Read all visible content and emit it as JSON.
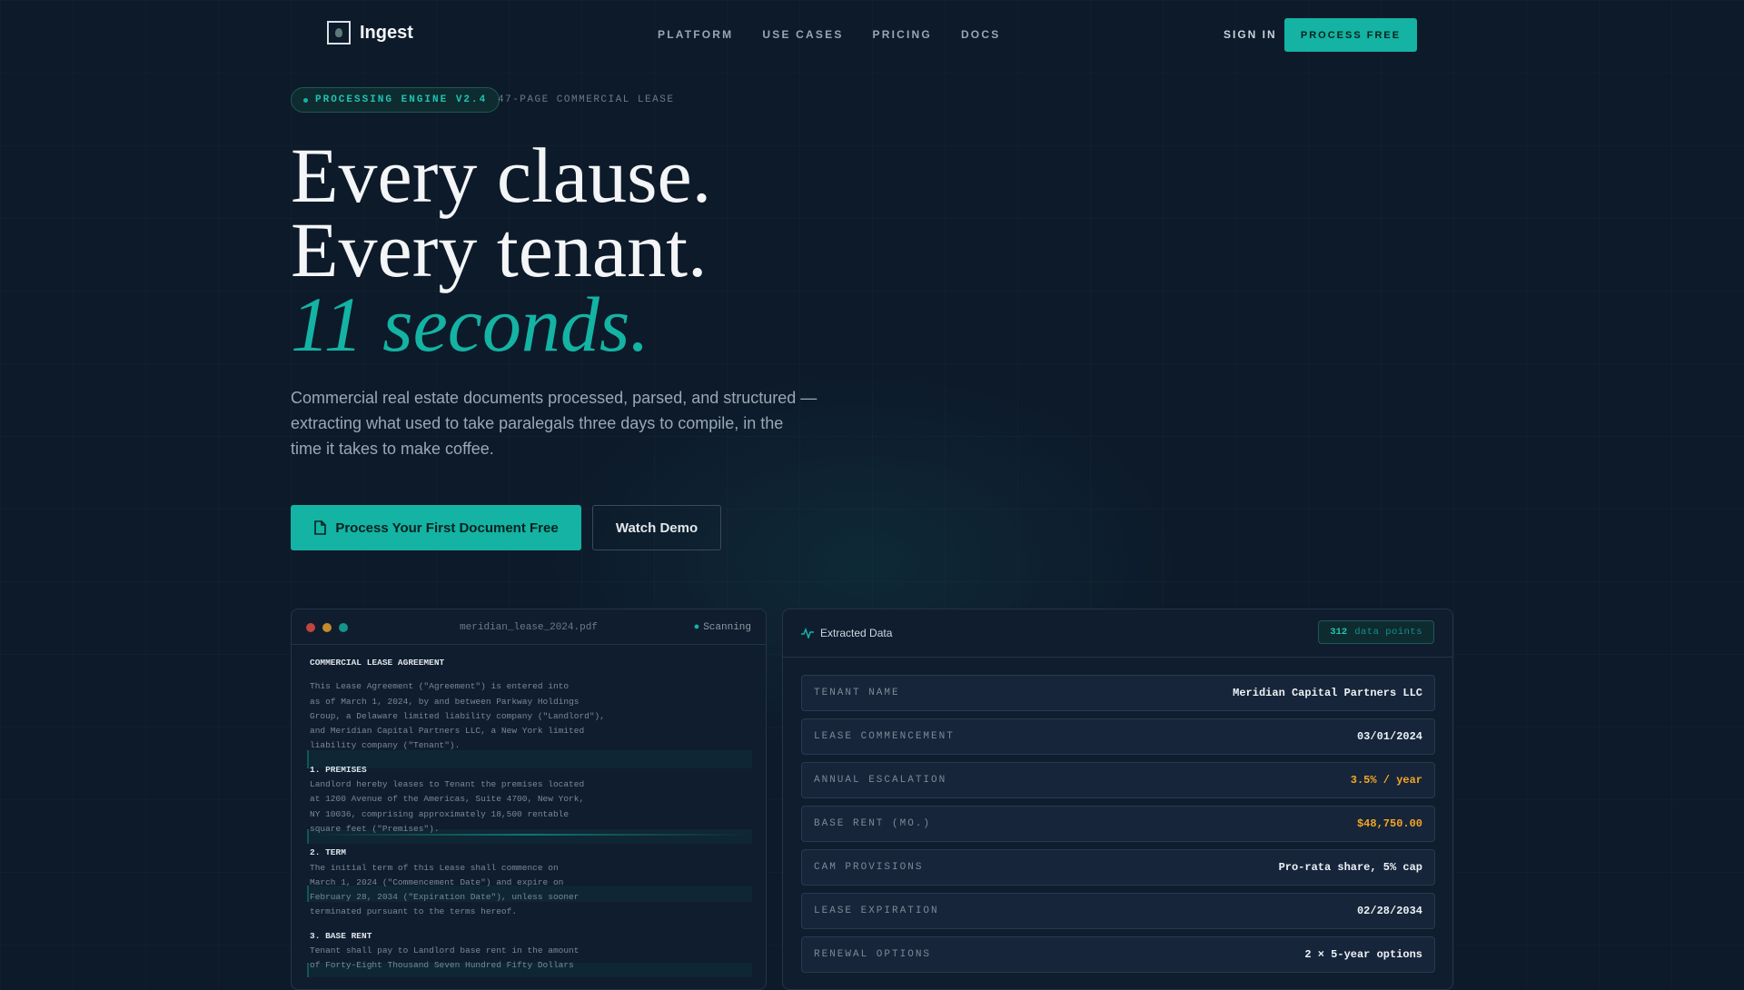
{
  "nav": {
    "logo": "Ingest",
    "links": [
      "PLATFORM",
      "USE CASES",
      "PRICING",
      "DOCS"
    ],
    "sign_in": "SIGN IN",
    "cta": "PROCESS FREE"
  },
  "hero": {
    "badge": "PROCESSING ENGINE V2.4",
    "badge_meta": "47-PAGE COMMERCIAL LEASE",
    "headline_1": "Every clause.",
    "headline_2": "Every tenant.",
    "headline_3": "11 seconds.",
    "subtitle": "Commercial real estate documents processed, parsed, and structured — extracting what used to take paralegals three days to compile, in the time it takes to make coffee.",
    "primary_button": "Process Your First Document Free",
    "secondary_button": "Watch Demo"
  },
  "document": {
    "filename": "meridian_lease_2024.pdf",
    "status": "Scanning",
    "title": "COMMERCIAL LEASE AGREEMENT",
    "intro": [
      "This Lease Agreement (\"Agreement\") is entered into",
      "as of March 1, 2024, by and between Parkway Holdings",
      "Group, a Delaware limited liability company (\"Landlord\"),",
      "and Meridian Capital Partners LLC, a New York limited",
      "liability company (\"Tenant\")."
    ],
    "sections": [
      {
        "heading": "1. PREMISES",
        "lines": [
          "Landlord hereby leases to Tenant the premises located",
          "at 1200 Avenue of the Americas, Suite 4700, New York,",
          "NY 10036, comprising approximately 18,500 rentable",
          "square feet (\"Premises\")."
        ]
      },
      {
        "heading": "2. TERM",
        "lines": [
          "The initial term of this Lease shall commence on",
          "March 1, 2024 (\"Commencement Date\") and expire on",
          "February 28, 2034 (\"Expiration Date\"), unless sooner",
          "terminated pursuant to the terms hereof."
        ]
      },
      {
        "heading": "3. BASE RENT",
        "lines": [
          "Tenant shall pay to Landlord base rent in the amount",
          "of Forty-Eight Thousand Seven Hundred Fifty Dollars"
        ]
      }
    ]
  },
  "extracted": {
    "title": "Extracted Data",
    "count": "312",
    "count_label": "data points",
    "rows": [
      {
        "key": "TENANT NAME",
        "value": "Meridian Capital Partners LLC",
        "highlight": false
      },
      {
        "key": "LEASE COMMENCEMENT",
        "value": "03/01/2024",
        "highlight": false
      },
      {
        "key": "ANNUAL ESCALATION",
        "value": "3.5% / year",
        "highlight": true
      },
      {
        "key": "BASE RENT (MO.)",
        "value": "$48,750.00",
        "highlight": true
      },
      {
        "key": "CAM PROVISIONS",
        "value": "Pro-rata share, 5% cap",
        "highlight": false
      },
      {
        "key": "LEASE EXPIRATION",
        "value": "02/28/2034",
        "highlight": false
      },
      {
        "key": "RENEWAL OPTIONS",
        "value": "2 × 5-year options",
        "highlight": false
      }
    ]
  },
  "colors": {
    "accent": "#14b3a3",
    "background": "#0d1a2a",
    "warning": "#f5a623"
  }
}
